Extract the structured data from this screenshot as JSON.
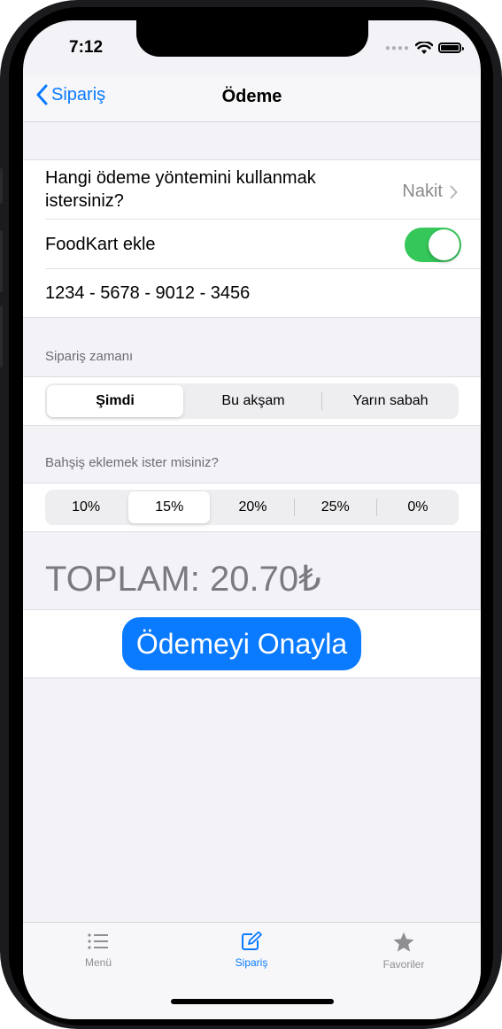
{
  "status_bar": {
    "time": "7:12"
  },
  "nav": {
    "back_label": "Sipariş",
    "title": "Ödeme"
  },
  "payment": {
    "method_question": "Hangi ödeme yöntemini kullanmak istersiniz?",
    "method_value": "Nakit",
    "foodkart_label": "FoodKart ekle",
    "foodkart_on": true,
    "card_number": "1234 - 5678 - 9012 - 3456"
  },
  "order_time": {
    "header": "Sipariş zamanı",
    "options": [
      "Şimdi",
      "Bu akşam",
      "Yarın sabah"
    ],
    "selected": "Şimdi"
  },
  "tip": {
    "header": "Bahşiş eklemek ister misiniz?",
    "options": [
      "10%",
      "15%",
      "20%",
      "25%",
      "0%"
    ],
    "selected": "15%"
  },
  "total": "TOPLAM: 20.70₺",
  "confirm_button": "Ödemeyi Onayla",
  "tabbar": {
    "items": [
      {
        "label": "Menü",
        "icon": "list-icon",
        "active": false
      },
      {
        "label": "Sipariş",
        "icon": "compose-icon",
        "active": true
      },
      {
        "label": "Favoriler",
        "icon": "star-icon",
        "active": false
      }
    ]
  },
  "colors": {
    "accent": "#0a7aff",
    "toggle_on": "#35c759",
    "inactive_tab": "#8e8e93"
  }
}
